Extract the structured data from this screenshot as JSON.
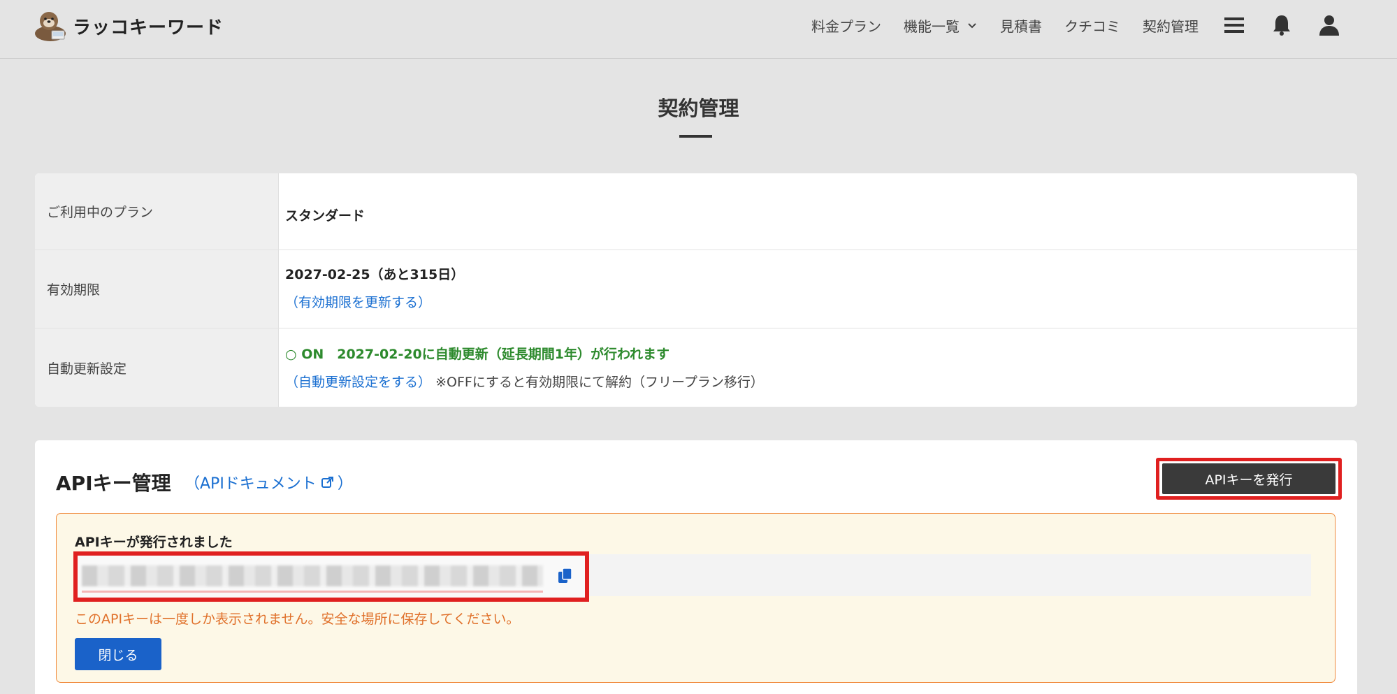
{
  "header": {
    "logo_text": "ラッコキーワード",
    "nav": [
      {
        "label": "料金プラン"
      },
      {
        "label": "機能一覧"
      },
      {
        "label": "見積書"
      },
      {
        "label": "クチコミ"
      },
      {
        "label": "契約管理"
      }
    ],
    "icons": [
      "menu-icon",
      "bell-icon",
      "user-icon"
    ]
  },
  "page": {
    "title": "契約管理"
  },
  "contract": {
    "plan_label": "ご利用中のプラン",
    "plan_value": "スタンダード",
    "expiry_label": "有効期限",
    "expiry_value": "2027-02-25（あと315日）",
    "expiry_link": "（有効期限を更新する）",
    "auto_label": "自動更新設定",
    "auto_status": "○ ON　2027-02-20に自動更新（延長期間1年）が行われます",
    "auto_link": "（自動更新設定をする）",
    "auto_note": "※OFFにすると有効期限にて解約（フリープラン移行）"
  },
  "api": {
    "title": "APIキー管理",
    "doc_link_open": "（APIドキュメント",
    "doc_link_close": "）",
    "issue_button": "APIキーを発行",
    "notice_title": "APIキーが発行されました",
    "warning": "このAPIキーは一度しか表示されません。安全な場所に保存してください。",
    "close_button": "閉じる"
  },
  "colors": {
    "link": "#1a6fd1",
    "status_green": "#2d8a2d",
    "warning_orange": "#e0702a",
    "highlight_red": "#e02020",
    "primary_button": "#1a62c9"
  }
}
